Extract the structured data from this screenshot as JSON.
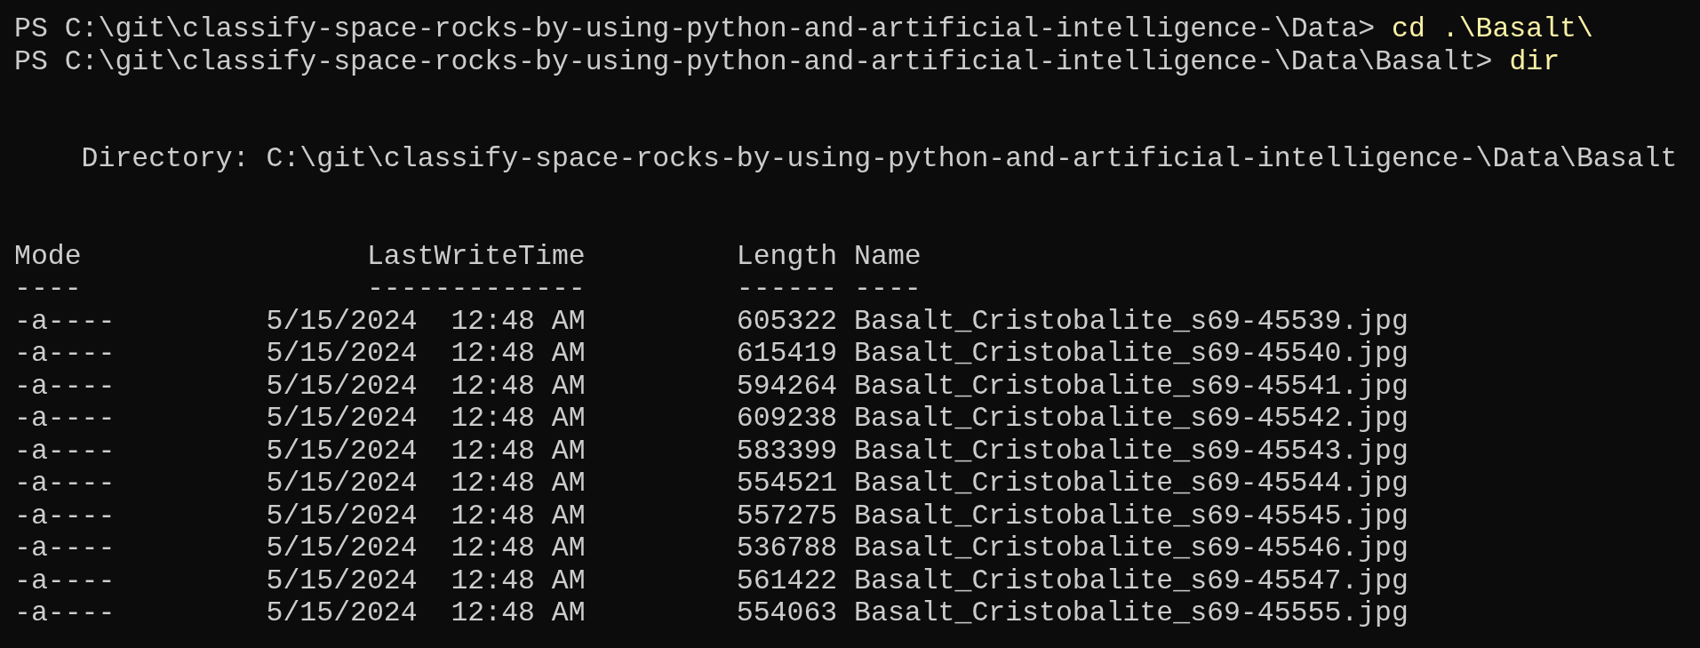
{
  "prompt_lines": [
    {
      "prompt": "PS C:\\git\\classify-space-rocks-by-using-python-and-artificial-intelligence-\\Data>",
      "command": "cd .\\Basalt\\"
    },
    {
      "prompt": "PS C:\\git\\classify-space-rocks-by-using-python-and-artificial-intelligence-\\Data\\Basalt>",
      "command": "dir"
    }
  ],
  "directory": {
    "label": "Directory:",
    "path": "C:\\git\\classify-space-rocks-by-using-python-and-artificial-intelligence-\\Data\\Basalt"
  },
  "columns": [
    {
      "header": "Mode",
      "underline": "----"
    },
    {
      "header": "LastWriteTime",
      "underline": "-------------"
    },
    {
      "header": "Length",
      "underline": "------"
    },
    {
      "header": "Name",
      "underline": "----"
    }
  ],
  "rows": [
    {
      "mode": "-a----",
      "date": "5/15/2024",
      "time": "12:48 AM",
      "length": "605322",
      "name": "Basalt_Cristobalite_s69-45539.jpg"
    },
    {
      "mode": "-a----",
      "date": "5/15/2024",
      "time": "12:48 AM",
      "length": "615419",
      "name": "Basalt_Cristobalite_s69-45540.jpg"
    },
    {
      "mode": "-a----",
      "date": "5/15/2024",
      "time": "12:48 AM",
      "length": "594264",
      "name": "Basalt_Cristobalite_s69-45541.jpg"
    },
    {
      "mode": "-a----",
      "date": "5/15/2024",
      "time": "12:48 AM",
      "length": "609238",
      "name": "Basalt_Cristobalite_s69-45542.jpg"
    },
    {
      "mode": "-a----",
      "date": "5/15/2024",
      "time": "12:48 AM",
      "length": "583399",
      "name": "Basalt_Cristobalite_s69-45543.jpg"
    },
    {
      "mode": "-a----",
      "date": "5/15/2024",
      "time": "12:48 AM",
      "length": "554521",
      "name": "Basalt_Cristobalite_s69-45544.jpg"
    },
    {
      "mode": "-a----",
      "date": "5/15/2024",
      "time": "12:48 AM",
      "length": "557275",
      "name": "Basalt_Cristobalite_s69-45545.jpg"
    },
    {
      "mode": "-a----",
      "date": "5/15/2024",
      "time": "12:48 AM",
      "length": "536788",
      "name": "Basalt_Cristobalite_s69-45546.jpg"
    },
    {
      "mode": "-a----",
      "date": "5/15/2024",
      "time": "12:48 AM",
      "length": "561422",
      "name": "Basalt_Cristobalite_s69-45547.jpg"
    },
    {
      "mode": "-a----",
      "date": "5/15/2024",
      "time": "12:48 AM",
      "length": "554063",
      "name": "Basalt_Cristobalite_s69-45555.jpg"
    }
  ]
}
